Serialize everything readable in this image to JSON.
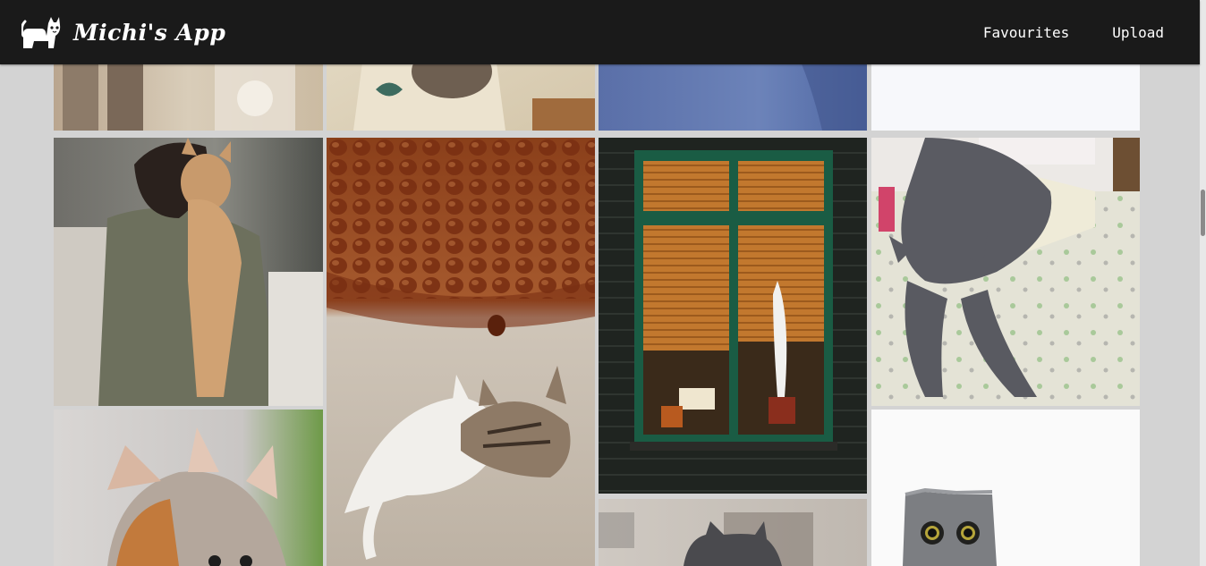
{
  "app": {
    "name": "Michi's App",
    "logo_icon": "cat-logo-icon"
  },
  "nav": {
    "favourites_label": "Favourites",
    "upload_label": "Upload"
  },
  "gallery": {
    "images": [
      {
        "subject": "cat-paws-on-lace-image"
      },
      {
        "subject": "kitten-in-paper-bag-image"
      },
      {
        "subject": "cat-on-blue-background-image"
      },
      {
        "subject": "white-background-image"
      },
      {
        "subject": "woman-holding-kitten-image"
      },
      {
        "subject": "kittens-sleeping-by-chestnuts-image"
      },
      {
        "subject": "cat-climbing-window-image"
      },
      {
        "subject": "grey-cat-stretching-from-box-image"
      },
      {
        "subject": "calico-kitten-closeup-image"
      },
      {
        "subject": "grey-cat-peeking-image"
      },
      {
        "subject": "wide-eyed-grey-cat-image"
      }
    ]
  },
  "colors": {
    "navbar": "#1a1a1a",
    "page_background": "#d3d3d3",
    "text": "#ffffff"
  }
}
